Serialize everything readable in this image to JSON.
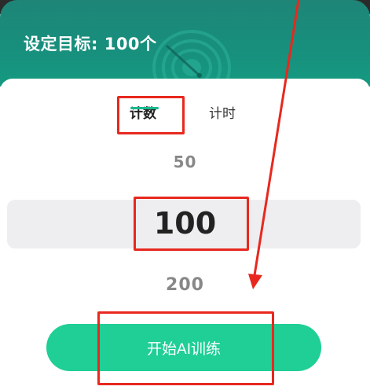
{
  "header": {
    "title": "设定目标: 100个"
  },
  "tabs": [
    {
      "label": "计数",
      "active": true
    },
    {
      "label": "计时",
      "active": false
    }
  ],
  "picker": {
    "previous": "50",
    "selected": "100",
    "next": "200"
  },
  "actions": {
    "start_label": "开始AI训练"
  },
  "colors": {
    "header": "#17907d",
    "accent": "#1fcf95",
    "tab_indicator": "#19b98f",
    "annotation": "#e8281e",
    "picker_band": "#eeeef0"
  }
}
